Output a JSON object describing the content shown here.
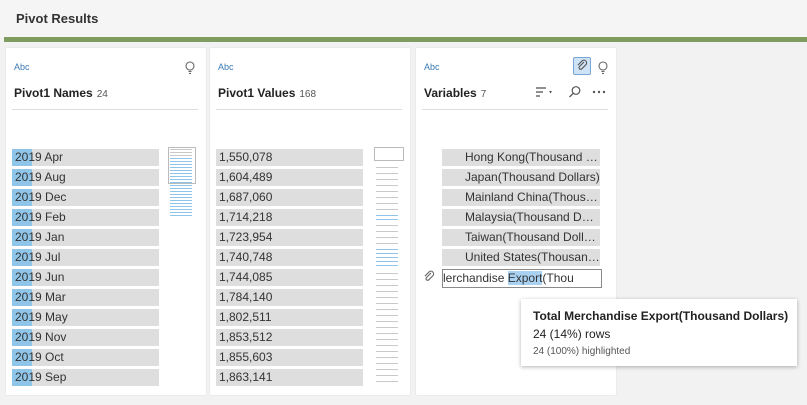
{
  "page": {
    "title": "Pivot Results"
  },
  "colors": {
    "accent_green": "#7f9d5f",
    "highlight_blue": "#8ec5e9",
    "selection_blue": "#a9d2f2"
  },
  "columns": [
    {
      "type": "Abc",
      "name": "Pivot1 Names",
      "count": "24",
      "rows": [
        "2019 Apr",
        "2019 Aug",
        "2019 Dec",
        "2019 Feb",
        "2019 Jan",
        "2019 Jul",
        "2019 Jun",
        "2019 Mar",
        "2019 May",
        "2019 Nov",
        "2019 Oct",
        "2019 Sep"
      ]
    },
    {
      "type": "Abc",
      "name": "Pivot1 Values",
      "count": "168",
      "rows": [
        "1,550,078",
        "1,604,489",
        "1,687,060",
        "1,714,218",
        "1,723,954",
        "1,740,748",
        "1,744,085",
        "1,784,140",
        "1,802,511",
        "1,853,512",
        "1,855,603",
        "1,863,141"
      ]
    },
    {
      "type": "Abc",
      "name": "Variables",
      "count": "7",
      "rows": [
        "Hong Kong(Thousand Dollars)",
        "Japan(Thousand Dollars)",
        "Mainland China(Thousand Dollars)",
        "Malaysia(Thousand Dollars)",
        "Taiwan(Thousand Dollars)",
        "United States(Thousand Dollars)"
      ],
      "edit_value_before": "lerchandise ",
      "edit_value_selected": "Export",
      "edit_value_after": "(Thou"
    }
  ],
  "tooltip": {
    "title": "Total Merchandise Export(Thousand Dollars)",
    "rows": "24 (14%) rows",
    "highlighted": "24 (100%) highlighted"
  },
  "icons": {
    "bulb": "lightbulb-icon",
    "paperclip": "paperclip-icon",
    "sort": "sort-icon",
    "search": "search-icon",
    "more": "more-icon"
  }
}
